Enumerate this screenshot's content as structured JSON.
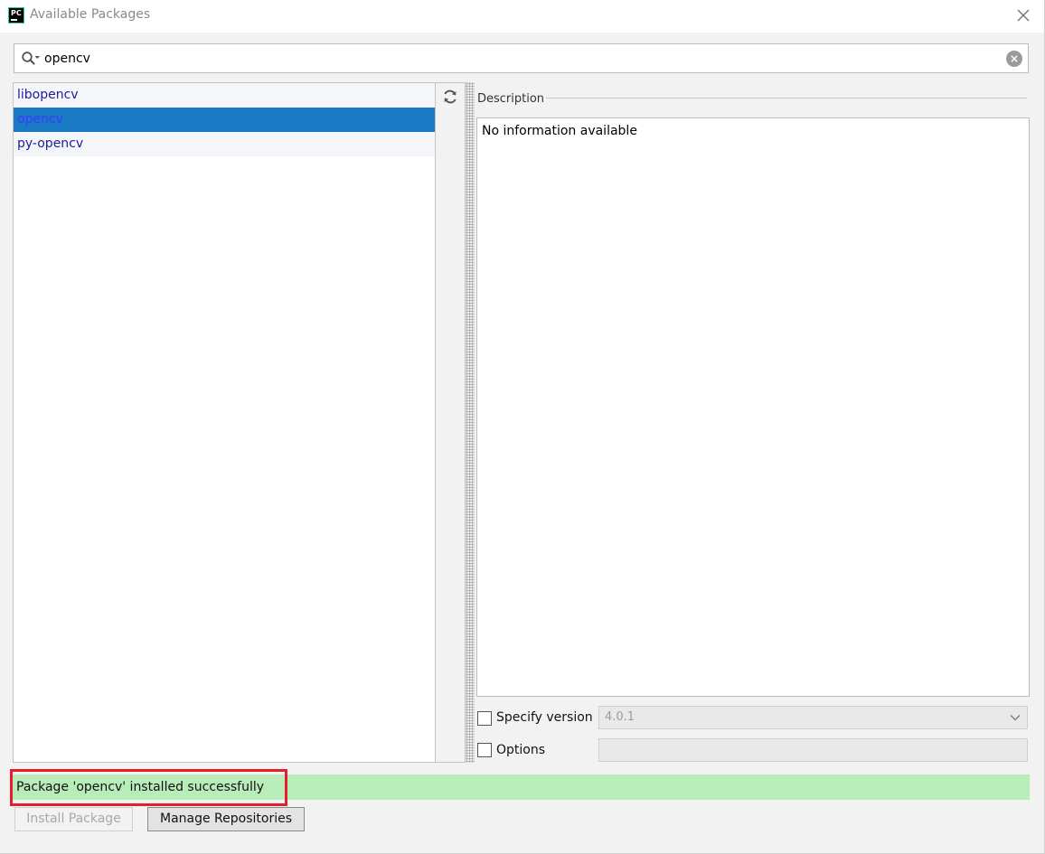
{
  "window": {
    "title": "Available Packages",
    "app_icon_text": "PC"
  },
  "search": {
    "value": "opencv",
    "icon": "search-icon"
  },
  "packages": [
    {
      "name": "libopencv",
      "selected": false
    },
    {
      "name": "opencv",
      "selected": true
    },
    {
      "name": "py-opencv",
      "selected": false
    }
  ],
  "description": {
    "label": "Description",
    "text": "No information available"
  },
  "options": {
    "specify_version_label": "Specify version",
    "specify_version_checked": false,
    "version_value": "4.0.1",
    "options_label": "Options",
    "options_checked": false,
    "options_value": ""
  },
  "status": {
    "message": "Package 'opencv' installed successfully",
    "color": "#b8ecb8"
  },
  "buttons": {
    "install_label": "Install Package",
    "manage_label": "Manage Repositories"
  },
  "colors": {
    "selection": "#1979c4",
    "highlight_border": "#e41e2b"
  }
}
